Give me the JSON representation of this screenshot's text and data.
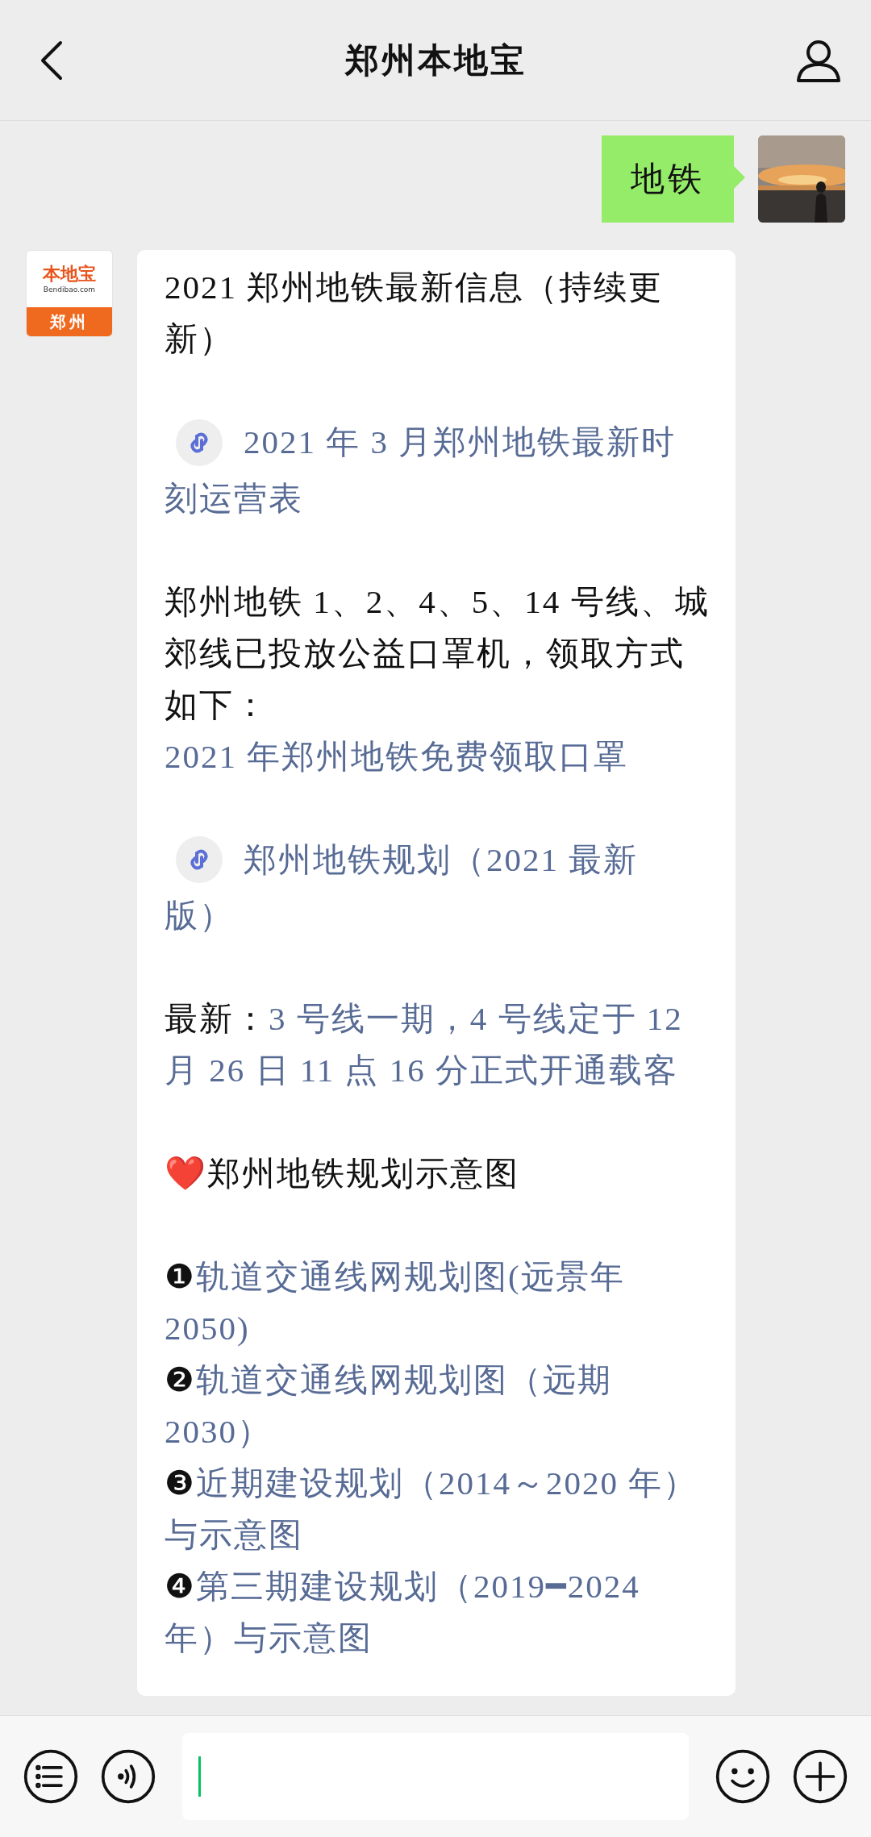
{
  "header": {
    "title": "郑州本地宝"
  },
  "messages": [
    {
      "kind": "sent_text",
      "text": "地铁"
    },
    {
      "kind": "received_article",
      "avatar": {
        "brand": "本地宝",
        "site": "Bendibao.com",
        "city": "郑州"
      },
      "blocks": [
        {
          "kind": "text",
          "lines": [
            [
              {
                "kind": "plain",
                "text": "2021 郑州地铁最新信息（持续更新）"
              }
            ]
          ]
        },
        {
          "kind": "miniprogram",
          "lines": [
            [
              {
                "kind": "link",
                "text": "2021 年 3 月郑州地铁最新时"
              }
            ],
            [
              {
                "kind": "link",
                "text": "刻运营表"
              }
            ]
          ]
        },
        {
          "kind": "text",
          "lines": [
            [
              {
                "kind": "plain",
                "text": "郑州地铁 1、2、4、5、14 号线、城郊线已投放公益口罩机，领取方式如下："
              }
            ],
            [
              {
                "kind": "link",
                "text": "2021 年郑州地铁免费领取口罩"
              }
            ]
          ]
        },
        {
          "kind": "miniprogram",
          "lines": [
            [
              {
                "kind": "link",
                "text": "郑州地铁规划（2021 最新"
              }
            ],
            [
              {
                "kind": "link",
                "text": "版）"
              }
            ]
          ]
        },
        {
          "kind": "text",
          "lines": [
            [
              {
                "kind": "plain",
                "text": "最新："
              },
              {
                "kind": "link",
                "text": "3 号线一期，4 号线定于 12"
              }
            ],
            [
              {
                "kind": "link",
                "text": "月 26 日 11 点 16 分正式开通载客"
              }
            ]
          ]
        },
        {
          "kind": "text",
          "lines": [
            [
              {
                "kind": "plain",
                "text": "❤️郑州地铁规划示意图"
              }
            ]
          ]
        },
        {
          "kind": "text",
          "lines": [
            [
              {
                "kind": "plain",
                "text": "❶"
              },
              {
                "kind": "link",
                "text": "轨道交通线网规划图(远景年"
              }
            ],
            [
              {
                "kind": "link",
                "text": "2050)"
              }
            ],
            [
              {
                "kind": "plain",
                "text": "❷"
              },
              {
                "kind": "link",
                "text": "轨道交通线网规划图（远期"
              }
            ],
            [
              {
                "kind": "link",
                "text": "2030）"
              }
            ],
            [
              {
                "kind": "plain",
                "text": "❸"
              },
              {
                "kind": "link",
                "text": "近期建设规划（2014～2020 年）"
              }
            ],
            [
              {
                "kind": "link",
                "text": "与示意图"
              }
            ],
            [
              {
                "kind": "plain",
                "text": "❹"
              },
              {
                "kind": "link",
                "text": "第三期建设规划（2019━2024"
              }
            ],
            [
              {
                "kind": "link",
                "text": "年）与示意图"
              }
            ]
          ]
        }
      ]
    }
  ]
}
